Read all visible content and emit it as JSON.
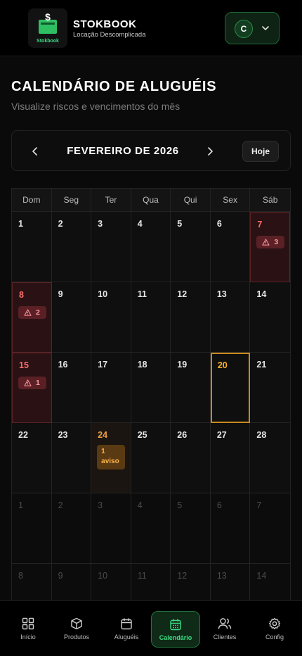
{
  "header": {
    "brand": "STOKBOOK",
    "tagline": "Locação Descomplicada",
    "logo_text": "Stokbook",
    "user_initial": "C"
  },
  "page": {
    "title": "CALENDÁRIO DE ALUGUÉIS",
    "subtitle": "Visualize riscos e vencimentos do mês"
  },
  "month_nav": {
    "label": "FEVEREIRO DE 2026",
    "today_label": "Hoje"
  },
  "calendar": {
    "weekdays": [
      "Dom",
      "Seg",
      "Ter",
      "Qua",
      "Qui",
      "Sex",
      "Sáb"
    ],
    "days": [
      {
        "d": "1"
      },
      {
        "d": "2"
      },
      {
        "d": "3"
      },
      {
        "d": "4"
      },
      {
        "d": "5"
      },
      {
        "d": "6"
      },
      {
        "d": "7",
        "risk": "3"
      },
      {
        "d": "8",
        "risk": "2"
      },
      {
        "d": "9"
      },
      {
        "d": "10"
      },
      {
        "d": "11"
      },
      {
        "d": "12"
      },
      {
        "d": "13"
      },
      {
        "d": "14"
      },
      {
        "d": "15",
        "risk": "1"
      },
      {
        "d": "16"
      },
      {
        "d": "17"
      },
      {
        "d": "18"
      },
      {
        "d": "19"
      },
      {
        "d": "20",
        "today": true
      },
      {
        "d": "21"
      },
      {
        "d": "22"
      },
      {
        "d": "23"
      },
      {
        "d": "24",
        "warn": "1 aviso"
      },
      {
        "d": "25"
      },
      {
        "d": "26"
      },
      {
        "d": "27"
      },
      {
        "d": "28"
      },
      {
        "d": "1",
        "faded": true
      },
      {
        "d": "2",
        "faded": true
      },
      {
        "d": "3",
        "faded": true
      },
      {
        "d": "4",
        "faded": true
      },
      {
        "d": "5",
        "faded": true
      },
      {
        "d": "6",
        "faded": true
      },
      {
        "d": "7",
        "faded": true
      },
      {
        "d": "8",
        "faded": true
      },
      {
        "d": "9",
        "faded": true
      },
      {
        "d": "10",
        "faded": true
      },
      {
        "d": "11",
        "faded": true
      },
      {
        "d": "12",
        "faded": true
      },
      {
        "d": "13",
        "faded": true
      },
      {
        "d": "14",
        "faded": true
      }
    ]
  },
  "bottom_nav": {
    "items": [
      {
        "label": "Início",
        "icon": "grid-icon"
      },
      {
        "label": "Produtos",
        "icon": "box-icon"
      },
      {
        "label": "Aluguéis",
        "icon": "calendar-icon"
      },
      {
        "label": "Calendário",
        "icon": "calendar-days-icon",
        "active": true
      },
      {
        "label": "Clientes",
        "icon": "users-icon"
      },
      {
        "label": "Config",
        "icon": "gear-icon"
      }
    ]
  },
  "colors": {
    "accent": "#3ddc84",
    "risk": "#ff6b6b",
    "today": "#c88a1d",
    "warning": "#ffb347"
  }
}
